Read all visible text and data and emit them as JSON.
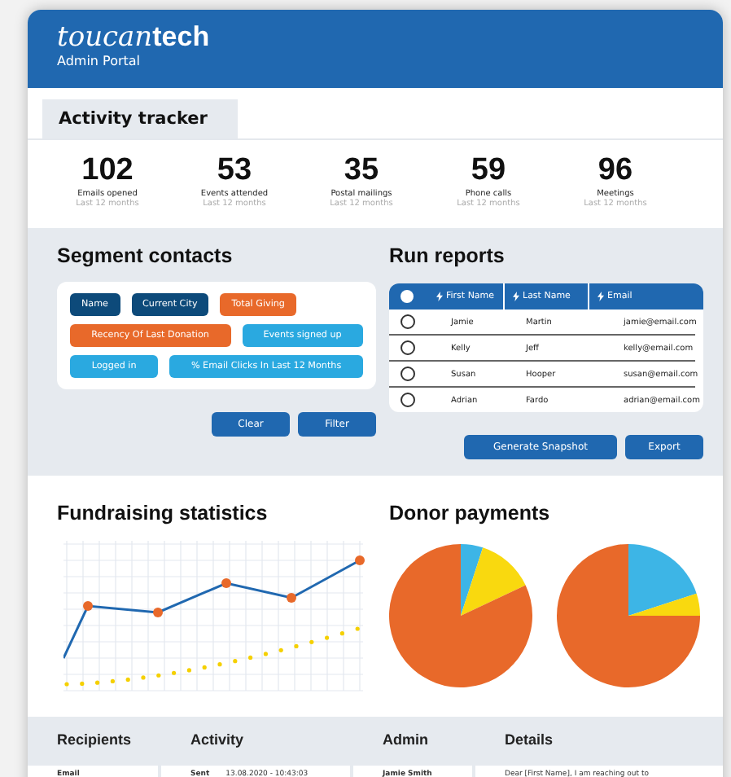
{
  "header": {
    "logo_script": "toucan",
    "logo_bold": "tech",
    "subtitle": "Admin Portal"
  },
  "tabs": [
    {
      "label": "Activity tracker",
      "selected": true
    }
  ],
  "stats": [
    {
      "value": "102",
      "label": "Emails opened",
      "period": "Last 12 months"
    },
    {
      "value": "53",
      "label": "Events attended",
      "period": "Last 12 months"
    },
    {
      "value": "35",
      "label": "Postal mailings",
      "period": "Last 12 months"
    },
    {
      "value": "59",
      "label": "Phone calls",
      "period": "Last 12 months"
    },
    {
      "value": "96",
      "label": "Meetings",
      "period": "Last 12 months"
    }
  ],
  "segment": {
    "title": "Segment contacts",
    "chips": [
      {
        "label": "Name",
        "color": "#0d4a7a"
      },
      {
        "label": "Current City",
        "color": "#0d4a7a"
      },
      {
        "label": "Total Giving",
        "color": "#e8692a"
      },
      {
        "label": "Recency Of Last Donation",
        "color": "#e8692a"
      },
      {
        "label": "Events signed up",
        "color": "#2aa9e0"
      },
      {
        "label": "Logged in",
        "color": "#2aa9e0"
      },
      {
        "label": "% Email Clicks In Last 12 Months",
        "color": "#2aa9e0"
      }
    ],
    "buttons": [
      "Clear",
      "Filter"
    ]
  },
  "reports": {
    "title": "Run reports",
    "select_all_checked": false,
    "columns": [
      "First Name",
      "Last Name",
      "Email"
    ],
    "rows": [
      {
        "cells": [
          "Jamie",
          "Martin",
          "jamie@email.com"
        ],
        "checked": false
      },
      {
        "cells": [
          "Kelly",
          "Jeff",
          "kelly@email.com"
        ],
        "checked": false
      },
      {
        "cells": [
          "Susan",
          "Hooper",
          "susan@email.com"
        ],
        "checked": false
      },
      {
        "cells": [
          "Adrian",
          "Fardo",
          "adrian@email.com"
        ],
        "checked": false
      }
    ],
    "buttons": [
      "Generate Snapshot",
      "Export"
    ]
  },
  "fundraising": {
    "title": "Fundraising statistics"
  },
  "donor": {
    "title": "Donor payments"
  },
  "activity_table": {
    "columns": [
      "Recipients",
      "Activity",
      "Admin",
      "Details"
    ],
    "rows": [
      [
        "Email",
        {
          "action": "Sent",
          "time": "13.08.2020 - 10:43:03"
        },
        "Jamie Smith",
        "Dear [First Name], I am reaching out to"
      ]
    ]
  }
}
